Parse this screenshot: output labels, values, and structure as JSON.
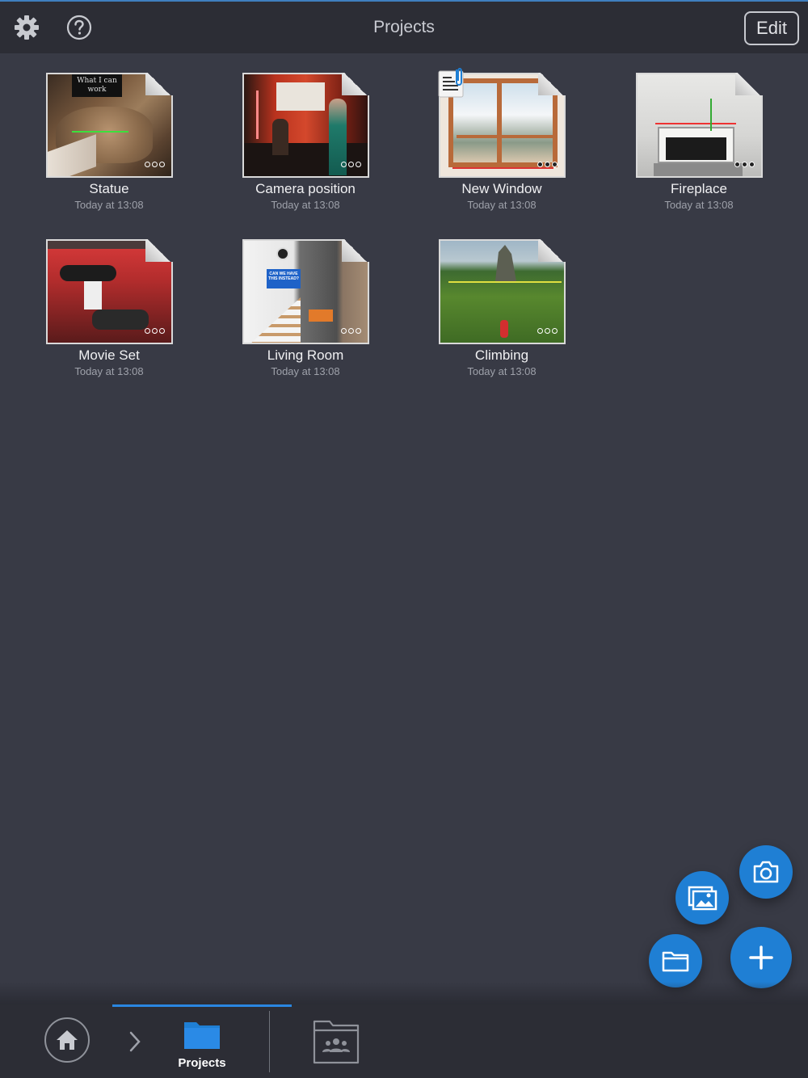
{
  "header": {
    "title": "Projects",
    "edit_label": "Edit"
  },
  "projects": [
    {
      "name": "Statue",
      "date": "Today at 13:08",
      "thumb_text": "What I can work"
    },
    {
      "name": "Camera position",
      "date": "Today at 13:08"
    },
    {
      "name": "New Window",
      "date": "Today at 13:08"
    },
    {
      "name": "Fireplace",
      "date": "Today at 13:08"
    },
    {
      "name": "Movie Set",
      "date": "Today at 13:08"
    },
    {
      "name": "Living Room",
      "date": "Today at 13:08",
      "thumb_text": "CAN WE HAVE THIS INSTEAD?"
    },
    {
      "name": "Climbing",
      "date": "Today at 13:08"
    }
  ],
  "bottom_nav": {
    "projects_label": "Projects"
  },
  "colors": {
    "accent": "#1f7fd4",
    "background": "#383a45",
    "bar": "#2c2d35"
  },
  "icons": [
    "gear-icon",
    "help-icon",
    "camera-icon",
    "gallery-icon",
    "folder-icon",
    "plus-icon",
    "home-icon",
    "chevron-right-icon",
    "shared-folder-icon",
    "attachment-icon"
  ]
}
